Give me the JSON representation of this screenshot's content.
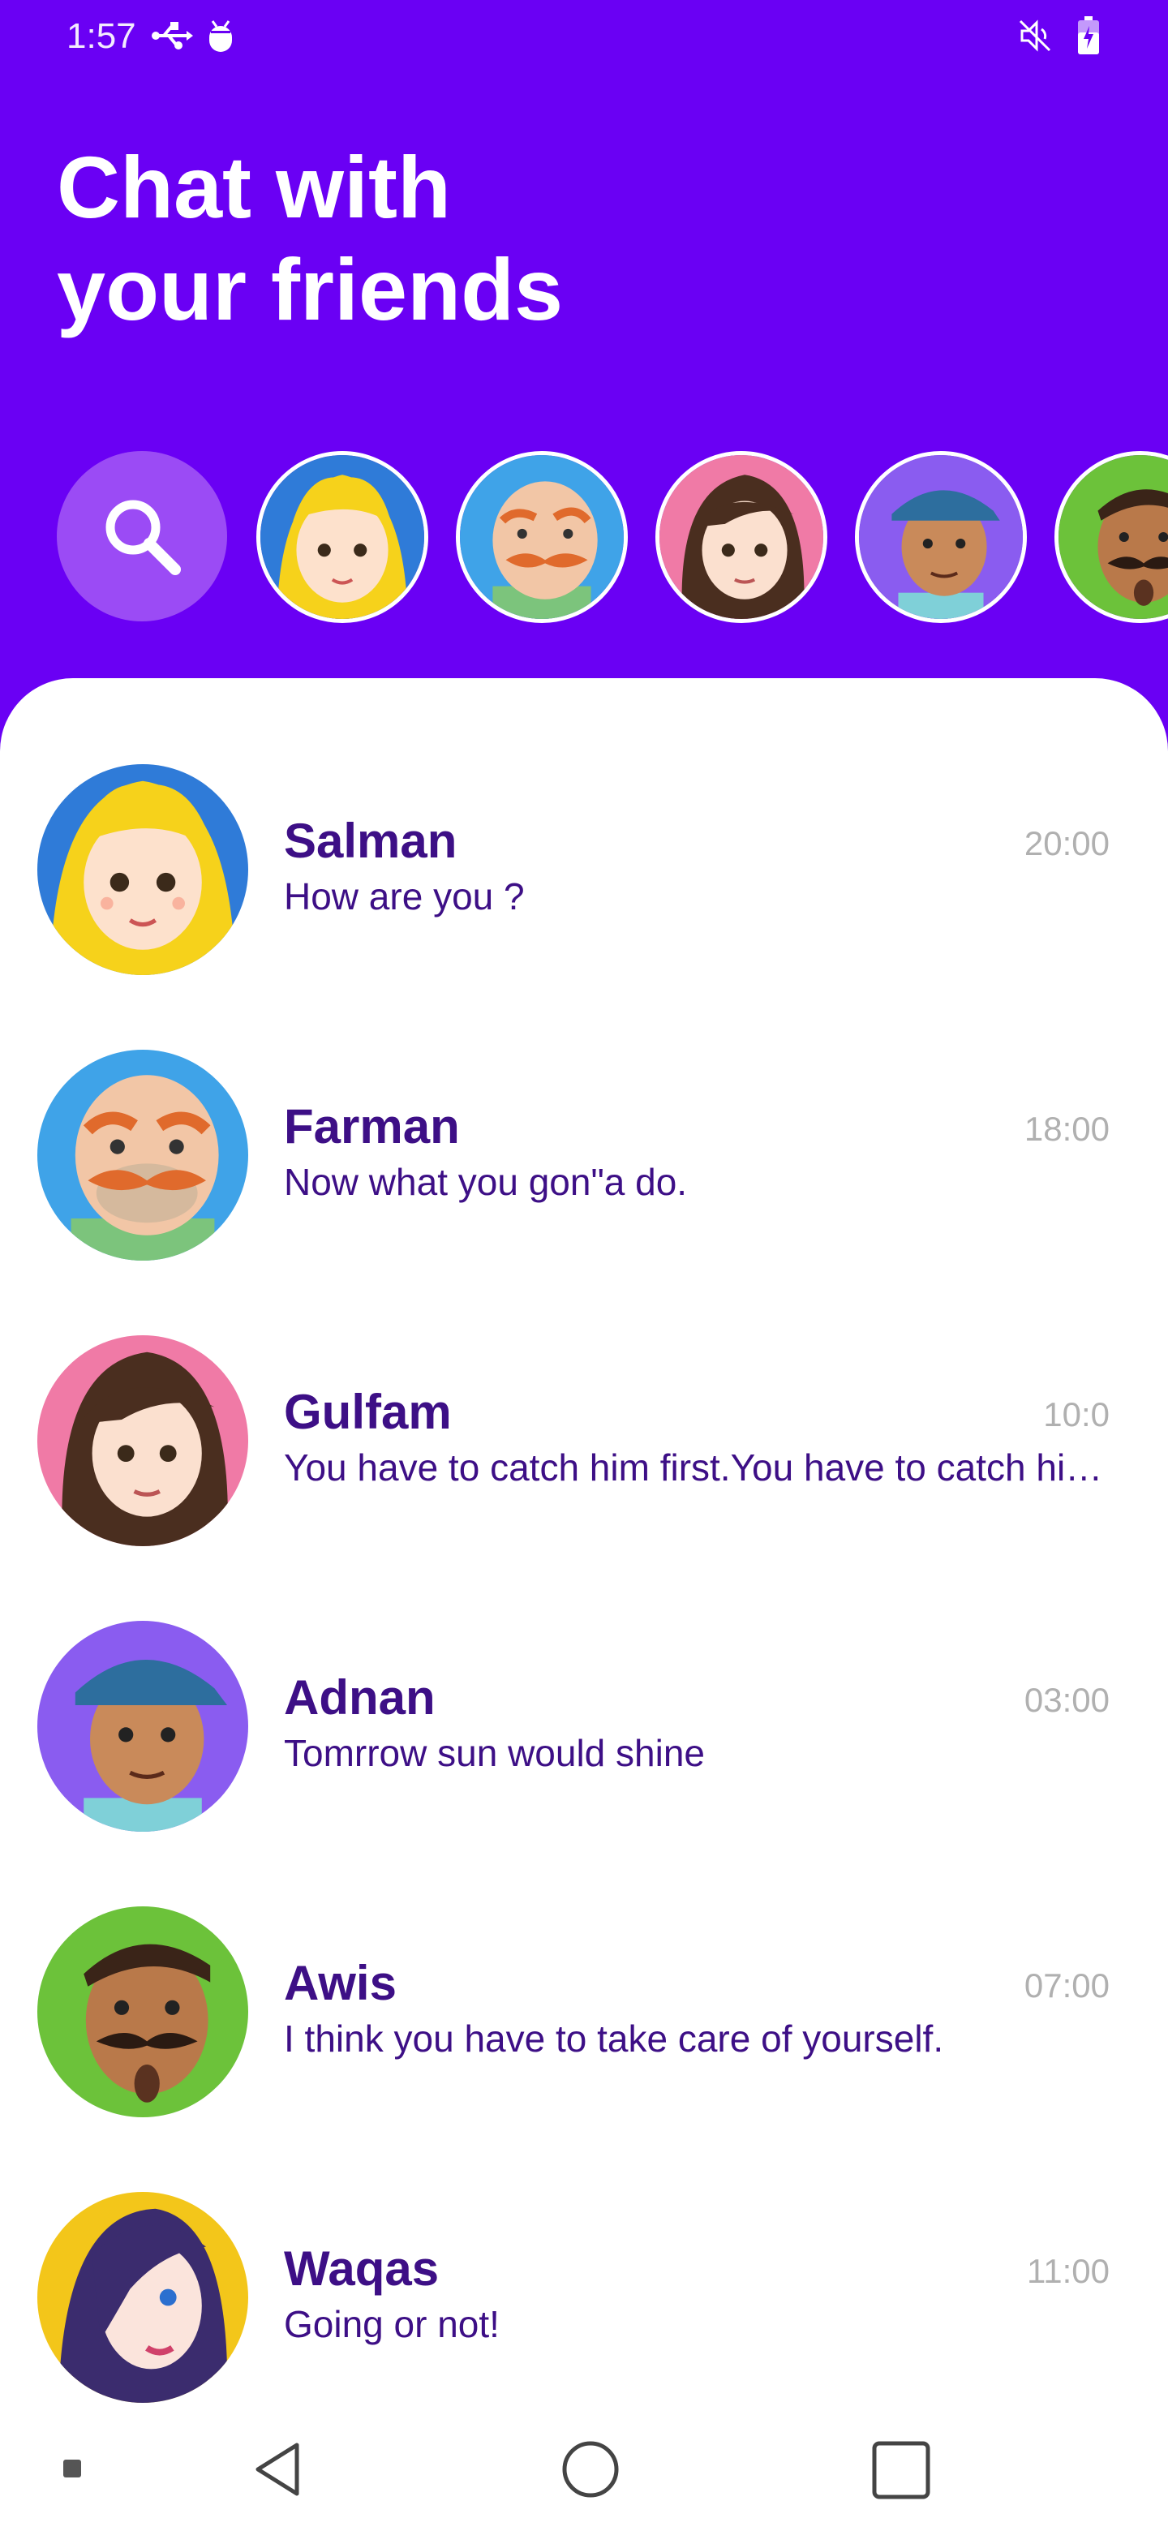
{
  "status_bar": {
    "time": "1:57",
    "icons": [
      "usb-icon",
      "debug-icon",
      "mute-icon",
      "battery-icon"
    ]
  },
  "header": {
    "title_line1": "Chat with",
    "title_line2": "your friends"
  },
  "stories": {
    "search_icon": "search-icon",
    "avatars": [
      "Salman",
      "Farman",
      "Gulfam",
      "Adnan",
      "Awis"
    ]
  },
  "chats": [
    {
      "name": "Salman",
      "message": "How are you ?",
      "time": "20:00"
    },
    {
      "name": "Farman",
      "message": "Now what you gon\"a do.",
      "time": "18:00"
    },
    {
      "name": "Gulfam",
      "message": "You have to catch him first.You have to catch him first.",
      "time": "10:0"
    },
    {
      "name": "Adnan",
      "message": "Tomrrow sun would shine",
      "time": "03:00"
    },
    {
      "name": "Awis",
      "message": "I think you have to take care of yourself.",
      "time": "07:00"
    },
    {
      "name": "Waqas",
      "message": "Going or not!",
      "time": "11:00"
    }
  ],
  "colors": {
    "primary": "#6a00f4",
    "search_bg": "#9b4bf5",
    "text_primary": "#3d0f86",
    "time_gray": "#b0b0b0"
  },
  "nav": [
    "back-icon",
    "home-icon",
    "recents-icon"
  ]
}
